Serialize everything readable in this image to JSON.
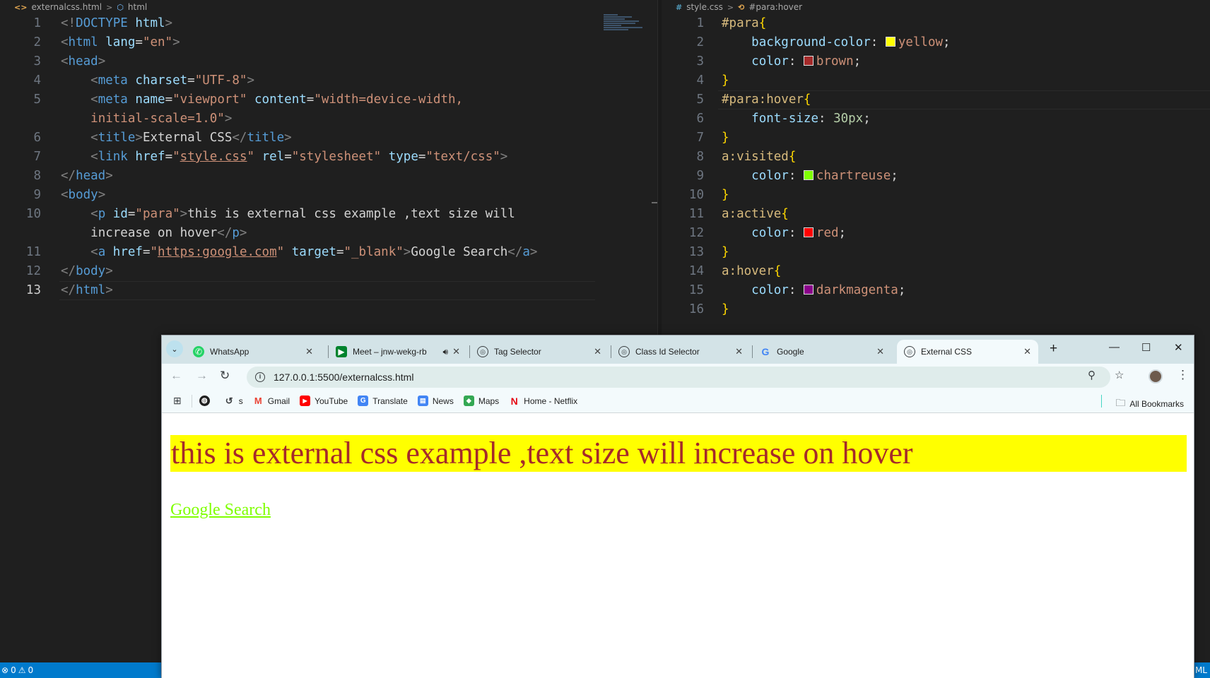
{
  "editor_left": {
    "breadcrumb": {
      "file": "externalcss.html",
      "node": "html"
    },
    "lines": [
      {
        "n": "1",
        "html": "<span class=\"tg\">&lt;!</span><span class=\"tn\">DOCTYPE</span><span class=\"tx\"> </span><span class=\"an\">html</span><span class=\"tg\">&gt;</span>"
      }
    ],
    "active_line": "13"
  },
  "editor_right": {
    "breadcrumb": {
      "file": "style.css",
      "node": "#para:hover"
    },
    "active_line": "16"
  },
  "statusbar": {
    "problems": "0",
    "warnings": "0",
    "right_text": "ML"
  },
  "browser": {
    "tabs": [
      {
        "label": "WhatsApp",
        "icon": "whatsapp-icon"
      },
      {
        "label": "Meet – jnw-wekg-rb",
        "icon": "meet-icon"
      },
      {
        "label": "Tag Selector",
        "icon": "globe-icon"
      },
      {
        "label": "Class Id Selector",
        "icon": "globe-icon"
      },
      {
        "label": "Google",
        "icon": "google-icon"
      },
      {
        "label": "External CSS",
        "icon": "globe-icon"
      }
    ],
    "active_tab": "External CSS",
    "url": "127.0.0.1:5500/externalcss.html",
    "bookmarks": [
      "s",
      "Gmail",
      "YouTube",
      "Translate",
      "News",
      "Maps",
      "Home - Netflix"
    ],
    "all_bookmarks": "All Bookmarks",
    "page": {
      "paragraph": "this is external css example ,text size will increase on hover",
      "link": "Google Search"
    }
  },
  "colors": {
    "para_bg": "#ffff00",
    "para_fg": "#a52a2a",
    "link": "#7fff00",
    "statusbar": "#007acc"
  }
}
